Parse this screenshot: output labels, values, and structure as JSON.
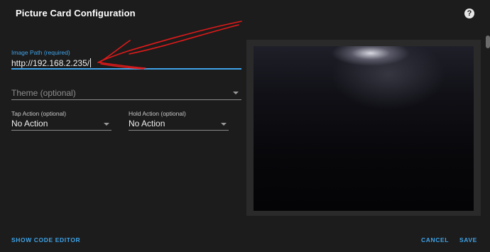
{
  "dialog": {
    "title": "Picture Card Configuration",
    "help_icon": "help-circle-icon"
  },
  "form": {
    "image_path": {
      "label": "Image Path (required)",
      "value": "http://192.168.2.235/"
    },
    "theme": {
      "placeholder": "Theme (optional)",
      "icon": "chevron-down-icon"
    },
    "tap_action": {
      "label": "Tap Action (optional)",
      "value": "No Action",
      "icon": "chevron-down-icon"
    },
    "hold_action": {
      "label": "Hold Action (optional)",
      "value": "No Action",
      "icon": "chevron-down-icon"
    }
  },
  "footer": {
    "show_code_editor": "SHOW CODE EDITOR",
    "cancel": "CANCEL",
    "save": "SAVE"
  },
  "colors": {
    "accent": "#3fa3e8",
    "background": "#1c1c1c",
    "annotation": "#e01a1a"
  }
}
